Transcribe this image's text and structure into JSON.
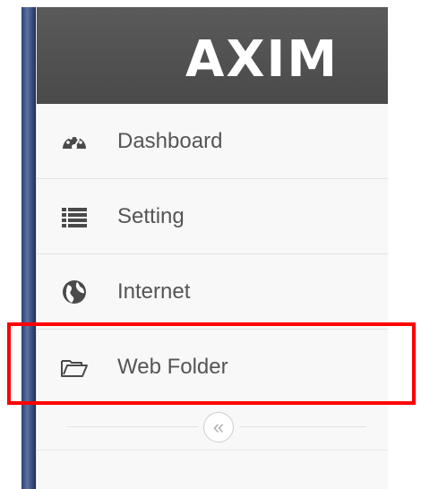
{
  "brand": {
    "text": "AXIM",
    "accent_color": "#ffffff"
  },
  "nav": {
    "items": [
      {
        "label": "Dashboard",
        "icon": "dashboard-icon"
      },
      {
        "label": "Setting",
        "icon": "list-icon"
      },
      {
        "label": "Internet",
        "icon": "globe-icon"
      },
      {
        "label": "Web Folder",
        "icon": "folder-open-icon"
      }
    ],
    "collapse_label": "«"
  },
  "colors": {
    "header_bg": "#4f4f4f",
    "sidebar_bg": "#f8f8f8",
    "text": "#555555",
    "highlight": "#ff0000"
  }
}
